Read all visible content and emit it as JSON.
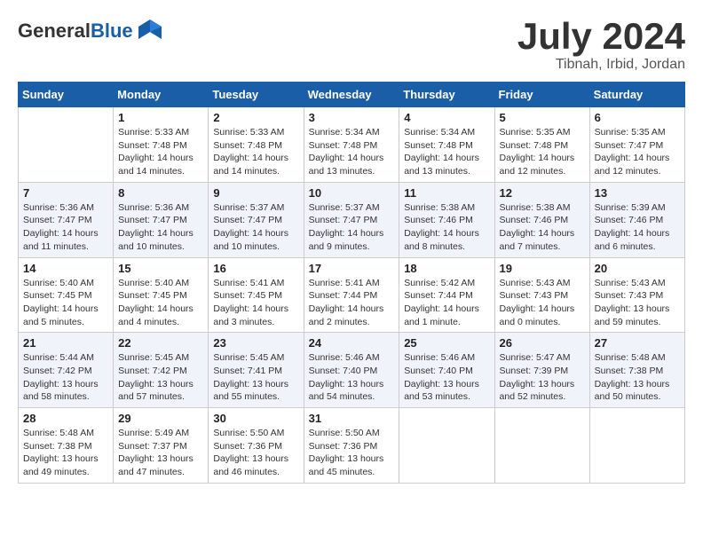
{
  "logo": {
    "general": "General",
    "blue": "Blue"
  },
  "title": "July 2024",
  "location": "Tibnah, Irbid, Jordan",
  "days_header": [
    "Sunday",
    "Monday",
    "Tuesday",
    "Wednesday",
    "Thursday",
    "Friday",
    "Saturday"
  ],
  "weeks": [
    [
      {
        "day": "",
        "info": ""
      },
      {
        "day": "1",
        "info": "Sunrise: 5:33 AM\nSunset: 7:48 PM\nDaylight: 14 hours\nand 14 minutes."
      },
      {
        "day": "2",
        "info": "Sunrise: 5:33 AM\nSunset: 7:48 PM\nDaylight: 14 hours\nand 14 minutes."
      },
      {
        "day": "3",
        "info": "Sunrise: 5:34 AM\nSunset: 7:48 PM\nDaylight: 14 hours\nand 13 minutes."
      },
      {
        "day": "4",
        "info": "Sunrise: 5:34 AM\nSunset: 7:48 PM\nDaylight: 14 hours\nand 13 minutes."
      },
      {
        "day": "5",
        "info": "Sunrise: 5:35 AM\nSunset: 7:48 PM\nDaylight: 14 hours\nand 12 minutes."
      },
      {
        "day": "6",
        "info": "Sunrise: 5:35 AM\nSunset: 7:47 PM\nDaylight: 14 hours\nand 12 minutes."
      }
    ],
    [
      {
        "day": "7",
        "info": "Sunrise: 5:36 AM\nSunset: 7:47 PM\nDaylight: 14 hours\nand 11 minutes."
      },
      {
        "day": "8",
        "info": "Sunrise: 5:36 AM\nSunset: 7:47 PM\nDaylight: 14 hours\nand 10 minutes."
      },
      {
        "day": "9",
        "info": "Sunrise: 5:37 AM\nSunset: 7:47 PM\nDaylight: 14 hours\nand 10 minutes."
      },
      {
        "day": "10",
        "info": "Sunrise: 5:37 AM\nSunset: 7:47 PM\nDaylight: 14 hours\nand 9 minutes."
      },
      {
        "day": "11",
        "info": "Sunrise: 5:38 AM\nSunset: 7:46 PM\nDaylight: 14 hours\nand 8 minutes."
      },
      {
        "day": "12",
        "info": "Sunrise: 5:38 AM\nSunset: 7:46 PM\nDaylight: 14 hours\nand 7 minutes."
      },
      {
        "day": "13",
        "info": "Sunrise: 5:39 AM\nSunset: 7:46 PM\nDaylight: 14 hours\nand 6 minutes."
      }
    ],
    [
      {
        "day": "14",
        "info": "Sunrise: 5:40 AM\nSunset: 7:45 PM\nDaylight: 14 hours\nand 5 minutes."
      },
      {
        "day": "15",
        "info": "Sunrise: 5:40 AM\nSunset: 7:45 PM\nDaylight: 14 hours\nand 4 minutes."
      },
      {
        "day": "16",
        "info": "Sunrise: 5:41 AM\nSunset: 7:45 PM\nDaylight: 14 hours\nand 3 minutes."
      },
      {
        "day": "17",
        "info": "Sunrise: 5:41 AM\nSunset: 7:44 PM\nDaylight: 14 hours\nand 2 minutes."
      },
      {
        "day": "18",
        "info": "Sunrise: 5:42 AM\nSunset: 7:44 PM\nDaylight: 14 hours\nand 1 minute."
      },
      {
        "day": "19",
        "info": "Sunrise: 5:43 AM\nSunset: 7:43 PM\nDaylight: 14 hours\nand 0 minutes."
      },
      {
        "day": "20",
        "info": "Sunrise: 5:43 AM\nSunset: 7:43 PM\nDaylight: 13 hours\nand 59 minutes."
      }
    ],
    [
      {
        "day": "21",
        "info": "Sunrise: 5:44 AM\nSunset: 7:42 PM\nDaylight: 13 hours\nand 58 minutes."
      },
      {
        "day": "22",
        "info": "Sunrise: 5:45 AM\nSunset: 7:42 PM\nDaylight: 13 hours\nand 57 minutes."
      },
      {
        "day": "23",
        "info": "Sunrise: 5:45 AM\nSunset: 7:41 PM\nDaylight: 13 hours\nand 55 minutes."
      },
      {
        "day": "24",
        "info": "Sunrise: 5:46 AM\nSunset: 7:40 PM\nDaylight: 13 hours\nand 54 minutes."
      },
      {
        "day": "25",
        "info": "Sunrise: 5:46 AM\nSunset: 7:40 PM\nDaylight: 13 hours\nand 53 minutes."
      },
      {
        "day": "26",
        "info": "Sunrise: 5:47 AM\nSunset: 7:39 PM\nDaylight: 13 hours\nand 52 minutes."
      },
      {
        "day": "27",
        "info": "Sunrise: 5:48 AM\nSunset: 7:38 PM\nDaylight: 13 hours\nand 50 minutes."
      }
    ],
    [
      {
        "day": "28",
        "info": "Sunrise: 5:48 AM\nSunset: 7:38 PM\nDaylight: 13 hours\nand 49 minutes."
      },
      {
        "day": "29",
        "info": "Sunrise: 5:49 AM\nSunset: 7:37 PM\nDaylight: 13 hours\nand 47 minutes."
      },
      {
        "day": "30",
        "info": "Sunrise: 5:50 AM\nSunset: 7:36 PM\nDaylight: 13 hours\nand 46 minutes."
      },
      {
        "day": "31",
        "info": "Sunrise: 5:50 AM\nSunset: 7:36 PM\nDaylight: 13 hours\nand 45 minutes."
      },
      {
        "day": "",
        "info": ""
      },
      {
        "day": "",
        "info": ""
      },
      {
        "day": "",
        "info": ""
      }
    ]
  ]
}
